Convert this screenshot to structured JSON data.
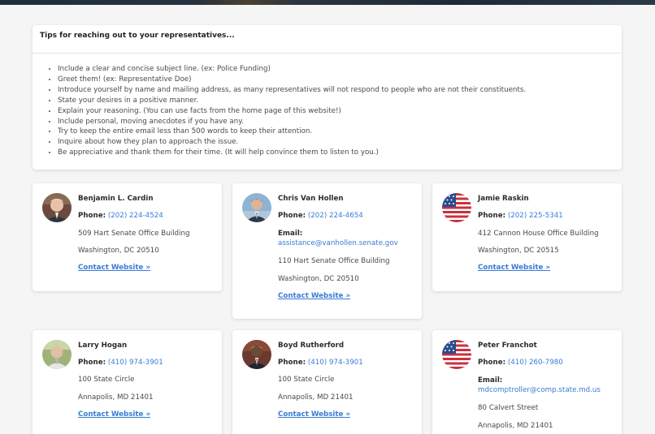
{
  "tips": {
    "title": "Tips for reaching out to your representatives...",
    "items": [
      "Include a clear and concise subject line. (ex: Police Funding)",
      "Greet them! (ex: Representative Doe)",
      "Introduce yourself by name and mailing address, as many representatives will not respond to people who are not their constituents.",
      "State your desires in a positive manner.",
      "Explain your reasoning. (You can use facts from the home page of this website!)",
      "Include personal, moving anecdotes if you have any.",
      "Try to keep the entire email less than 500 words to keep their attention.",
      "Inquire about how they plan to approach the issue.",
      "Be appreciative and thank them for their time. (It will help convince them to listen to you.)"
    ]
  },
  "labels": {
    "phone": "Phone:",
    "email": "Email:",
    "website": "Contact Website »"
  },
  "reps": [
    {
      "name": "Benjamin L. Cardin",
      "phone": "(202) 224-4524",
      "address1": "509 Hart Senate Office Building",
      "address2": "Washington, DC 20510",
      "avatar": "photo"
    },
    {
      "name": "Chris Van Hollen",
      "phone": "(202) 224-4654",
      "email": "assistance@vanhollen.senate.gov",
      "address1": "110 Hart Senate Office Building",
      "address2": "Washington, DC 20510",
      "avatar": "photo"
    },
    {
      "name": "Jamie Raskin",
      "phone": "(202) 225-5341",
      "address1": "412 Cannon House Office Building",
      "address2": "Washington, DC 20515",
      "avatar": "us-flag"
    },
    {
      "name": "Larry Hogan",
      "phone": "(410) 974-3901",
      "address1": "100 State Circle",
      "address2": "Annapolis, MD 21401",
      "avatar": "photo"
    },
    {
      "name": "Boyd Rutherford",
      "phone": "(410) 974-3901",
      "address1": "100 State Circle",
      "address2": "Annapolis, MD 21401",
      "avatar": "photo"
    },
    {
      "name": "Peter Franchot",
      "phone": "(410) 260-7980",
      "email": "mdcomptroller@comp.state.md.us",
      "address1": "80 Calvert Street",
      "address2": "Annapolis, MD 21401",
      "avatar": "us-flag"
    }
  ],
  "colors": {
    "link": "#3a7bd5",
    "flag_red": "#c8313e",
    "flag_blue": "#2a4c8f"
  }
}
